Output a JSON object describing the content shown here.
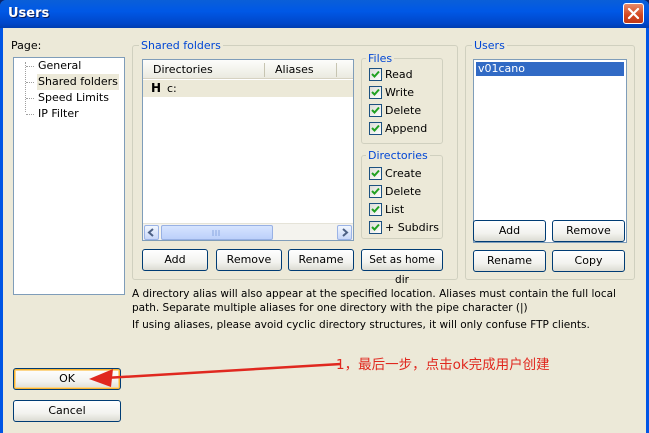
{
  "window": {
    "title": "Users",
    "close_icon": "close-icon"
  },
  "page_panel": {
    "label": "Page:",
    "items": [
      "General",
      "Shared folders",
      "Speed Limits",
      "IP Filter"
    ],
    "selected": "Shared folders"
  },
  "shared_folders": {
    "group_title": "Shared folders",
    "columns": [
      "Directories",
      "Aliases"
    ],
    "rows": [
      {
        "marker": "H",
        "directory": "c:",
        "alias": ""
      }
    ],
    "buttons": {
      "add": "Add",
      "remove": "Remove",
      "rename": "Rename",
      "set_home": "Set as home dir"
    }
  },
  "files": {
    "group_title": "Files",
    "options": [
      {
        "label": "Read",
        "checked": true
      },
      {
        "label": "Write",
        "checked": true
      },
      {
        "label": "Delete",
        "checked": true
      },
      {
        "label": "Append",
        "checked": true
      }
    ]
  },
  "directories": {
    "group_title": "Directories",
    "options": [
      {
        "label": "Create",
        "checked": true
      },
      {
        "label": "Delete",
        "checked": true
      },
      {
        "label": "List",
        "checked": true
      },
      {
        "label": "+ Subdirs",
        "checked": true
      }
    ]
  },
  "users": {
    "group_title": "Users",
    "items": [
      "v01cano"
    ],
    "selected": "v01cano",
    "buttons": {
      "add": "Add",
      "remove": "Remove",
      "rename": "Rename",
      "copy": "Copy"
    }
  },
  "notes": {
    "line1": "A directory alias will also appear at the specified location. Aliases must contain the full local",
    "line2": "path. Separate multiple aliases for one directory with the pipe character (|)",
    "line3": "If using aliases, please avoid cyclic directory structures, it will only confuse FTP clients."
  },
  "dialog_buttons": {
    "ok": "OK",
    "cancel": "Cancel"
  },
  "annotation": {
    "text": "1，最后一步，点击ok完成用户创建",
    "color": "#e0281f"
  },
  "colors": {
    "titlebar": "#0058e6",
    "dialog_bg": "#ece9d8",
    "group_title": "#0046d5",
    "selection": "#316ac5",
    "button_border": "#003c74"
  }
}
